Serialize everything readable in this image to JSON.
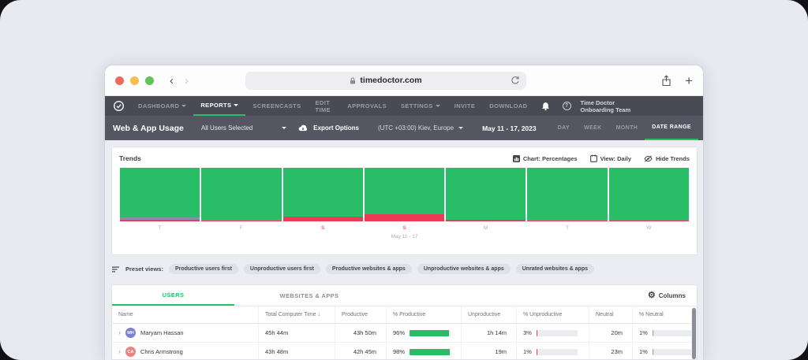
{
  "browser": {
    "url": "timedoctor.com"
  },
  "navbar": {
    "items": [
      {
        "label": "DASHBOARD"
      },
      {
        "label": "REPORTS"
      },
      {
        "label": "SCREENCASTS"
      },
      {
        "label": "EDIT TIME"
      },
      {
        "label": "APPROVALS"
      },
      {
        "label": "SETTINGS"
      },
      {
        "label": "INVITE"
      },
      {
        "label": "DOWNLOAD"
      }
    ],
    "active_item": "REPORTS",
    "team_name": "Time Doctor Onboarding Team"
  },
  "subheader": {
    "title": "Web & App Usage",
    "users_filter": "All Users Selected",
    "export_label": "Export Options",
    "timezone": "(UTC +03:00) Kiev, Europe",
    "date_label": "May 11 - 17, 2023",
    "range_tabs": [
      "DAY",
      "WEEK",
      "MONTH",
      "DATE RANGE"
    ],
    "active_range_tab": "DATE RANGE"
  },
  "trends": {
    "title": "Trends",
    "chart_toggle": "Chart: Percentages",
    "view_toggle": "View: Daily",
    "hide_label": "Hide Trends"
  },
  "chart_data": {
    "type": "bar",
    "stacked": true,
    "title": "Trends",
    "unit": "percent",
    "ylim": [
      0,
      100
    ],
    "categories": [
      "T",
      "F",
      "S",
      "S",
      "M",
      "T",
      "W"
    ],
    "weekend_flags": [
      false,
      false,
      true,
      true,
      false,
      false,
      false
    ],
    "period_label": "May 11 - 17",
    "series": [
      {
        "name": "Productive",
        "color": "#2abd68",
        "values": [
          93,
          97,
          91,
          87,
          97.5,
          97.5,
          98
        ]
      },
      {
        "name": "Neutral",
        "color": "#8f8aa8",
        "values": [
          3.5,
          1.5,
          0,
          0,
          0,
          1.5,
          0
        ]
      },
      {
        "name": "Unproductive",
        "color": "#ee3b55",
        "values": [
          3.5,
          1.5,
          9,
          13,
          2.5,
          1,
          2
        ]
      }
    ]
  },
  "presets": {
    "label": "Preset views:",
    "items": [
      "Productive users first",
      "Unproductive users first",
      "Productive websites & apps",
      "Unproductive websites & apps",
      "Unrated websites & apps"
    ]
  },
  "table": {
    "tabs": [
      "USERS",
      "WEBSITES & APPS"
    ],
    "active_tab": "USERS",
    "columns_label": "Columns",
    "headers": [
      "Name",
      "Total Computer Time",
      "Productive",
      "% Productive",
      "Unproductive",
      "% Unproductive",
      "Neutral",
      "% Neutral"
    ],
    "sorted_by": "Total Computer Time",
    "rows": [
      {
        "initials": "MH",
        "avatar_color": "#7b7fd3",
        "name": "Maryam Hassan",
        "total": "45h 44m",
        "productive": "43h 50m",
        "pct_productive": "96%",
        "pp": 96,
        "unproductive": "1h 14m",
        "pct_unproductive": "3%",
        "pu": 3,
        "neutral": "20m",
        "pct_neutral": "1%",
        "pn": 1
      },
      {
        "initials": "CA",
        "avatar_color": "#ec8181",
        "name": "Chris Armstrong",
        "total": "43h 48m",
        "productive": "42h 45m",
        "pct_productive": "98%",
        "pp": 98,
        "unproductive": "19m",
        "pct_unproductive": "1%",
        "pu": 1,
        "neutral": "23m",
        "pct_neutral": "1%",
        "pn": 1
      }
    ]
  },
  "colors": {
    "accent_green": "#2abd68",
    "unproductive_red": "#ee3b55",
    "weekend_label": "#f06a7e",
    "navbar_bg": "#4a4a55",
    "subheader_bg": "#565663"
  }
}
